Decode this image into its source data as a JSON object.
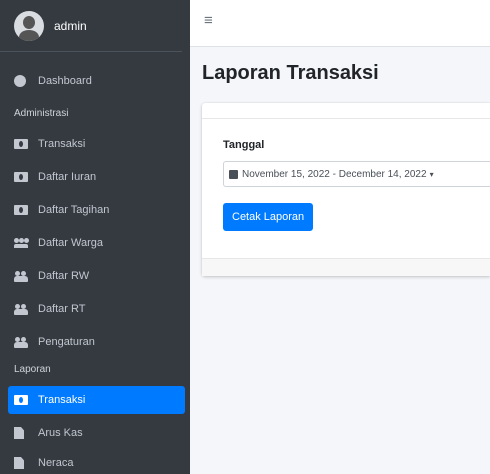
{
  "user": {
    "name": "admin"
  },
  "sidebar": {
    "dashboard": "Dashboard",
    "header_administrasi": "Administrasi",
    "admin_items": [
      {
        "label": "Transaksi",
        "icon": "money-icon"
      },
      {
        "label": "Daftar Iuran",
        "icon": "money-icon"
      },
      {
        "label": "Daftar Tagihan",
        "icon": "money-icon"
      },
      {
        "label": "Daftar Warga",
        "icon": "users-icon"
      },
      {
        "label": "Daftar RW",
        "icon": "people-icon"
      },
      {
        "label": "Daftar RT",
        "icon": "people-icon"
      },
      {
        "label": "Pengaturan",
        "icon": "people-icon"
      }
    ],
    "header_laporan": "Laporan",
    "laporan_items": [
      {
        "label": "Transaksi",
        "icon": "money-icon",
        "active": true
      },
      {
        "label": "Arus Kas",
        "icon": "file-icon"
      },
      {
        "label": "Neraca",
        "icon": "file-icon"
      }
    ]
  },
  "topbar": {
    "menu_icon": "hamburger-icon",
    "menu_glyph": "≡"
  },
  "page": {
    "title": "Laporan Transaksi"
  },
  "form": {
    "label": "Tanggal",
    "date_range": "November 15, 2022 - December 14, 2022",
    "caret": "▾",
    "button": "Cetak Laporan"
  },
  "colors": {
    "sidebar_bg": "#343a40",
    "accent": "#007bff",
    "content_bg": "#f4f6f9"
  }
}
